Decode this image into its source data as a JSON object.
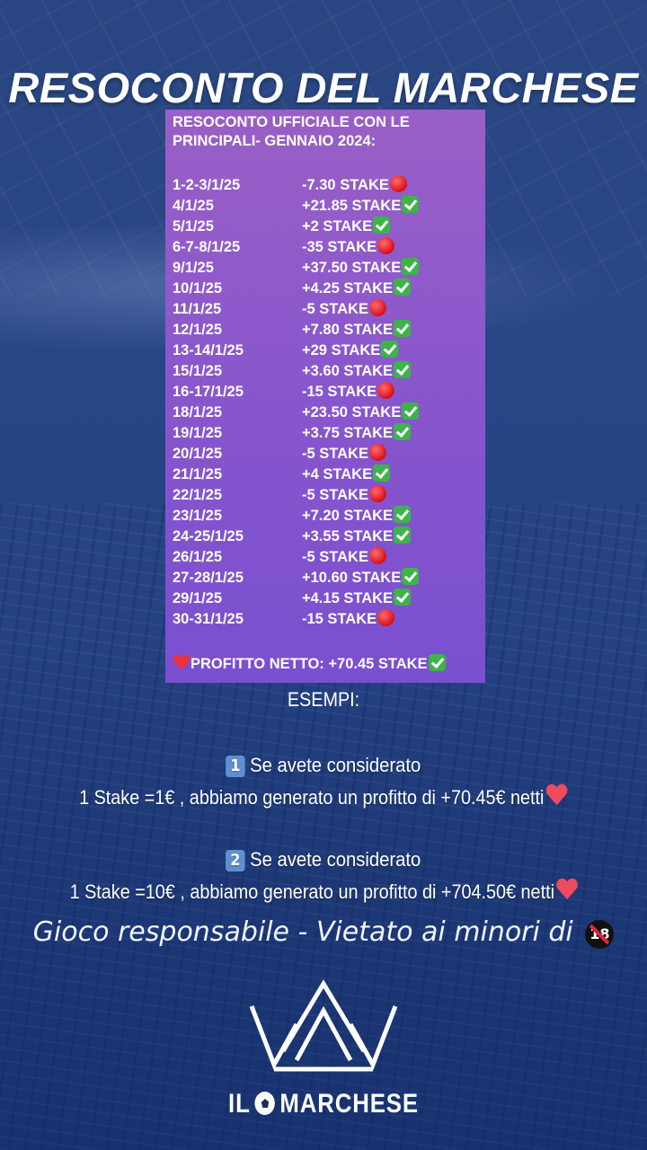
{
  "header": {
    "title": "RESOCONTO DEL MARCHESE"
  },
  "report": {
    "heading_line1": "RESOCONTO UFFICIALE CON LE",
    "heading_line2": "PRINCIPALI- GENNAIO 2024:",
    "rows": [
      {
        "date": "1-2-3/1/25",
        "value": "-7.30 STAKE",
        "status": "loss"
      },
      {
        "date": "4/1/25",
        "value": "+21.85 STAKE",
        "status": "win"
      },
      {
        "date": "5/1/25",
        "value": "+2 STAKE",
        "status": "win"
      },
      {
        "date": "6-7-8/1/25",
        "value": "-35 STAKE",
        "status": "loss"
      },
      {
        "date": "9/1/25",
        "value": "+37.50 STAKE",
        "status": "win"
      },
      {
        "date": "10/1/25",
        "value": "+4.25 STAKE",
        "status": "win"
      },
      {
        "date": "11/1/25",
        "value": "-5 STAKE",
        "status": "loss"
      },
      {
        "date": "12/1/25",
        "value": "+7.80 STAKE",
        "status": "win"
      },
      {
        "date": "13-14/1/25",
        "value": "+29 STAKE",
        "status": "win"
      },
      {
        "date": "15/1/25",
        "value": "+3.60 STAKE",
        "status": "win"
      },
      {
        "date": "16-17/1/25",
        "value": "-15 STAKE",
        "status": "loss"
      },
      {
        "date": "18/1/25",
        "value": "+23.50 STAKE",
        "status": "win"
      },
      {
        "date": "19/1/25",
        "value": "+3.75 STAKE",
        "status": "win"
      },
      {
        "date": "20/1/25",
        "value": "-5 STAKE",
        "status": "loss"
      },
      {
        "date": "21/1/25",
        "value": "+4 STAKE",
        "status": "win"
      },
      {
        "date": "22/1/25",
        "value": "-5 STAKE",
        "status": "loss"
      },
      {
        "date": "23/1/25",
        "value": "+7.20 STAKE",
        "status": "win"
      },
      {
        "date": "24-25/1/25",
        "value": "+3.55 STAKE",
        "status": "win"
      },
      {
        "date": "26/1/25",
        "value": "-5 STAKE",
        "status": "loss"
      },
      {
        "date": "27-28/1/25",
        "value": "+10.60 STAKE",
        "status": "win"
      },
      {
        "date": "29/1/25",
        "value": "+4.15 STAKE",
        "status": "win"
      },
      {
        "date": "30-31/1/25",
        "value": "-15  STAKE",
        "status": "loss"
      }
    ],
    "net_profit": "PROFITTO NETTO: +70.45 STAKE"
  },
  "examples": {
    "title": "ESEMPI:",
    "items": [
      {
        "number": "1",
        "line1": "Se avete considerato",
        "line2": "1 Stake =1€ , abbiamo generato un profitto di +70.45€ netti"
      },
      {
        "number": "2",
        "line1": "Se avete considerato",
        "line2": "1 Stake =10€ , abbiamo generato un profitto di +704.50€ netti"
      }
    ]
  },
  "disclaimer": {
    "text": "Gioco responsabile - Vietato ai minori di",
    "age": "18"
  },
  "brand": {
    "left": "IL",
    "right": "MARCHESE"
  },
  "colors": {
    "win": "#3db34a",
    "loss": "#d90f1a",
    "panel": "#8a57cc",
    "background": "#2c4a86"
  }
}
